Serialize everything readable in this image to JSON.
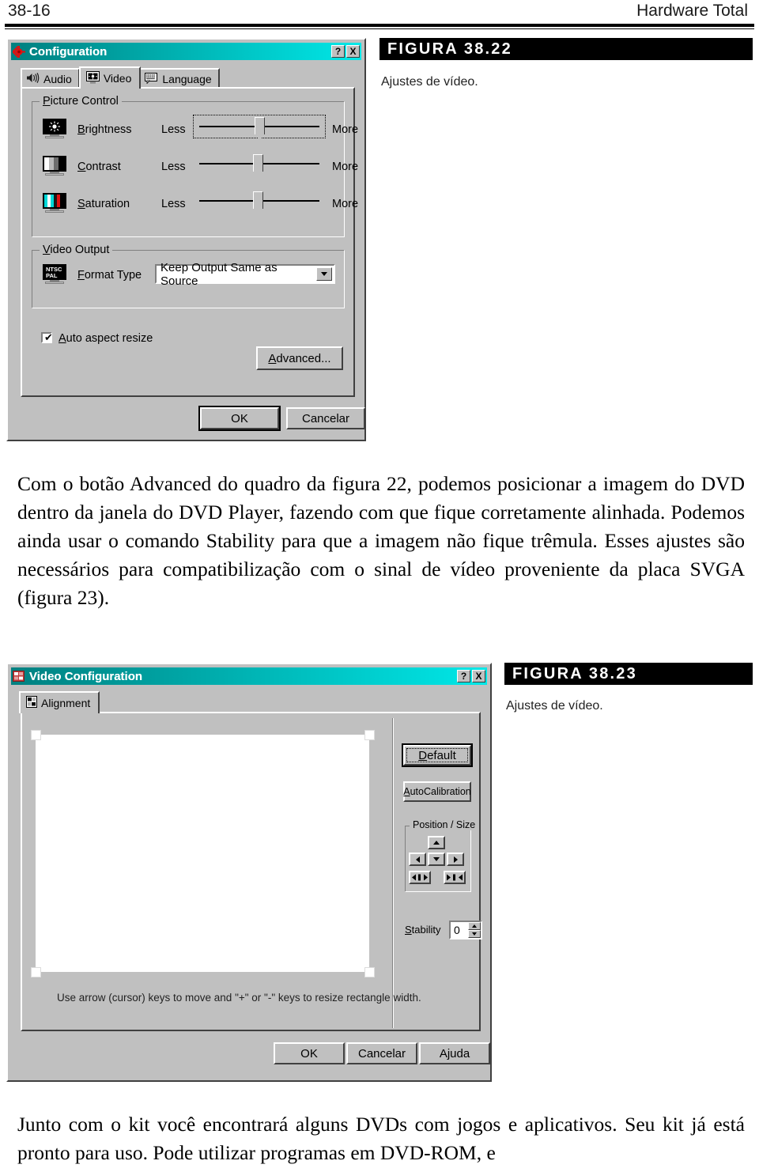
{
  "page": {
    "number": "38-16",
    "book_title": "Hardware Total"
  },
  "figures": [
    {
      "label": "FIGURA 38.22",
      "caption": "Ajustes de vídeo."
    },
    {
      "label": "FIGURA 38.23",
      "caption": "Ajustes de vídeo."
    }
  ],
  "paragraphs": {
    "p1": "Com o botão Advanced do quadro da figura 22, podemos posicionar a imagem do DVD dentro da janela do DVD Player, fazendo com que fique corretamente alinhada. Podemos ainda usar o comando Stability para que a imagem não fique trêmula. Esses ajustes são necessários para compatibilização com o sinal de vídeo proveniente da placa SVGA (figura 23).",
    "p2": "Junto com o kit você encontrará alguns DVDs com jogos e aplicativos. Seu kit já está pronto para uso. Pode utilizar programas em DVD-ROM, e"
  },
  "dialog_configuration": {
    "title": "Configuration",
    "titlebar_icon": "gear-icon",
    "help_button": "?",
    "close_button": "X",
    "tabs": [
      {
        "label": "Audio",
        "icon": "speaker-icon",
        "active": false
      },
      {
        "label": "Video",
        "icon": "monitor-icon",
        "active": true
      },
      {
        "label": "Language",
        "icon": "keyboard-icon",
        "active": false
      }
    ],
    "picture_control": {
      "title": "Picture Control",
      "sliders": [
        {
          "label": "Brightness",
          "icon": "brightness-monitor-icon",
          "min_label": "Less",
          "max_label": "More",
          "value_pct": 50,
          "focused": true
        },
        {
          "label": "Contrast",
          "icon": "contrast-monitor-icon",
          "min_label": "Less",
          "max_label": "More",
          "value_pct": 50,
          "focused": false
        },
        {
          "label": "Saturation",
          "icon": "saturation-monitor-icon",
          "min_label": "Less",
          "max_label": "More",
          "value_pct": 50,
          "focused": false
        }
      ]
    },
    "video_output": {
      "title": "Video Output",
      "format_type_label": "Format Type",
      "format_type_icon": "ntsc-pal-monitor-icon",
      "format_type_value": "Keep Output Same as Source"
    },
    "auto_aspect_resize": {
      "label": "Auto aspect resize",
      "checked": true
    },
    "advanced_button": "Advanced...",
    "ok_button": "OK",
    "cancel_button": "Cancelar"
  },
  "dialog_video_configuration": {
    "title": "Video Configuration",
    "titlebar_icon": "alignment-icon",
    "help_button": "?",
    "close_button": "X",
    "tabs": [
      {
        "label": "Alignment",
        "icon": "alignment-icon",
        "active": true
      }
    ],
    "default_button": "Default",
    "autocalibration_button": "AutoCalibration",
    "position_size": {
      "title": "Position / Size",
      "buttons": [
        {
          "name": "move-up",
          "glyph": "▲"
        },
        {
          "name": "move-left",
          "glyph": "◀"
        },
        {
          "name": "move-down",
          "glyph": "▼"
        },
        {
          "name": "move-right",
          "glyph": "▶"
        },
        {
          "name": "widen",
          "glyph": "◀▮▶"
        },
        {
          "name": "narrow",
          "glyph": "▶▮◀"
        }
      ]
    },
    "stability": {
      "label": "Stability",
      "value": "0"
    },
    "hint": "Use arrow (cursor) keys to move and \"+\" or \"-\" keys to resize rectangle width.",
    "ok_button": "OK",
    "cancel_button": "Cancelar",
    "help_button_label": "Ajuda"
  },
  "colors": {
    "titlebar_from": "#008080",
    "titlebar_to": "#00e8e8",
    "face": "#c0c0c0",
    "shadow": "#404040"
  }
}
